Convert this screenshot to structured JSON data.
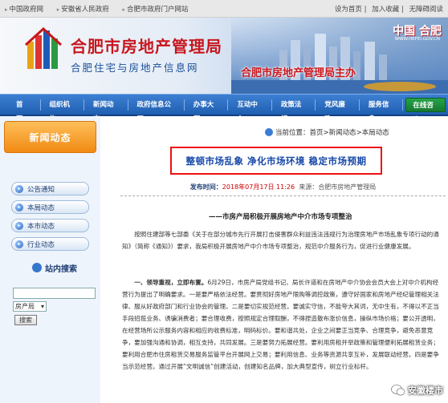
{
  "topbar": {
    "links": [
      "中国政府网",
      "安徽省人民政府",
      "合肥市政府门户网站"
    ],
    "right": [
      "设为首页",
      "加入收藏",
      "无障碍阅读"
    ]
  },
  "banner": {
    "title": "合肥市房地产管理局",
    "subtitle": "合肥住宅与房地产信息网",
    "brand": "中国 合肥",
    "brand_url": "WWW.HEFEI.GOV.CN",
    "slogan": "合肥市房地产管理局主办"
  },
  "nav": {
    "items": [
      "首 页",
      "组织机构",
      "新闻动态",
      "政府信息公开",
      "办事大厅",
      "互动中心",
      "政策法规",
      "党风廉政",
      "服务信息",
      "在线咨询"
    ],
    "active_index": 9
  },
  "sidebar": {
    "title": "新闻动态",
    "items": [
      "公告通知",
      "本局动态",
      "本市动态",
      "行业动态"
    ],
    "search_title": "站内搜索",
    "search_value": "",
    "select_value": "房产局",
    "search_button": "搜索"
  },
  "main": {
    "breadcrumb": "当前位置：首页>新闻动态>本局动态",
    "headline": "整顿市场乱象  净化市场环境  稳定市场预期",
    "meta_label": "发布时间：",
    "meta_time": "2018年07月17日  11:26",
    "meta_source": "来源：合肥市房地产管理局",
    "subhead": "——市房产局积极开展房地产中介市场专项整治",
    "para1": "按照住建部等七部委《关于在部分城市先行开展打击侵害群众利益违法违规行为治理房地产市场乱象专项行动的通知》（简称《通知》）要求，我局积极开展房地产中介市场专项整治，规范中介服务行为，促进行业健康发展。",
    "para2_lead": "一、领导重视，立即布置。",
    "para2": "6月29日，市房产局党组书记、局长许道和在房地产中介协会会员大会上对中介机构经营行为提出了明确要求。一是要严格依法经营。要贯彻好房地产限购等调控政策，遵守好国家和房地产经纪管理相关法律、服从好政府部门和行业协会的管理。二是要切实规范经营。要诚实守信，不能夸大其词，无中生有，不得以不正当手段招揽业务、诱骗消费者；要合理收费，按照规定合理取酬，不得捏造散布涨价信息，操纵市场价格；要公开透明，在经营场所公示服务内容和相应的收费标准，明码标价。要和谐共处，企业之间要正当竞争、合理竞争，避免恶意竞争，要加强沟通和协调，相互支持，共同发展。三是要努力拓展经营。要利用房租并举政策和管理便利拓展租赁业务；要利用合肥市住房租赁交易服务监管平台开展网上交易；要利用信息、业务等资源共享互补，发展联动经营。四是要争当示范经营。通过开展“文明诚信”创建活动，创建知名品牌，加大典型宣传，树立行业标杆。"
  },
  "watermark": "安徽楼市"
}
